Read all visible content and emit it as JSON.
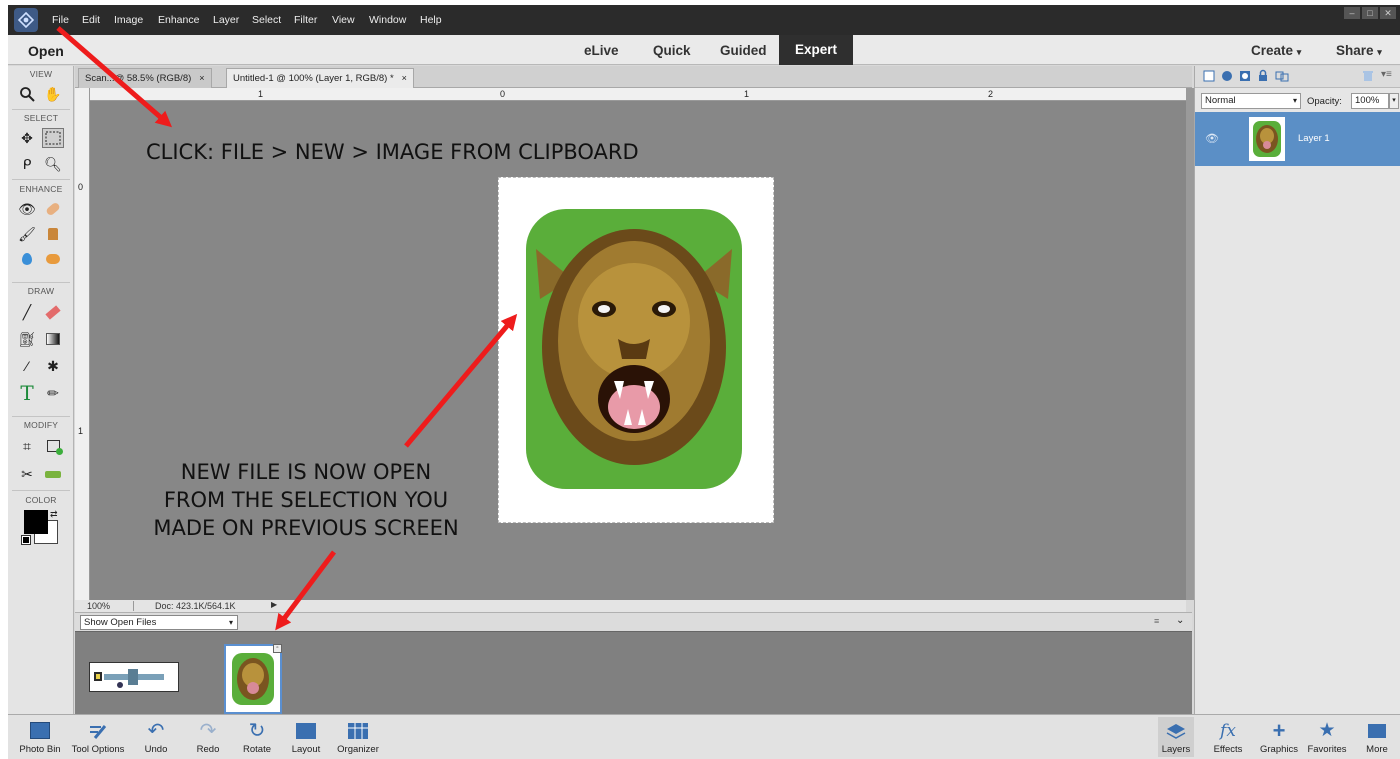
{
  "menubar": {
    "items": [
      "File",
      "Edit",
      "Image",
      "Enhance",
      "Layer",
      "Select",
      "Filter",
      "View",
      "Window",
      "Help"
    ],
    "window_controls": [
      "–",
      "□",
      "✕"
    ]
  },
  "modebar": {
    "open_label": "Open",
    "modes": [
      "eLive",
      "Quick",
      "Guided",
      "Expert"
    ],
    "active_mode": "Expert",
    "create_label": "Create",
    "share_label": "Share"
  },
  "toolbox": {
    "sections": [
      "VIEW",
      "SELECT",
      "ENHANCE",
      "DRAW",
      "MODIFY",
      "COLOR"
    ]
  },
  "doc_tabs": [
    {
      "label": "Scan...@ 58.5% (RGB/8)",
      "close": "×"
    },
    {
      "label": "Untitled-1 @ 100% (Layer 1, RGB/8) *",
      "close": "×"
    }
  ],
  "rulers": {
    "h_numbers": [
      "1",
      "0",
      "1",
      "2"
    ],
    "v_numbers": [
      "0",
      "1"
    ]
  },
  "status": {
    "zoom": "100%",
    "doc": "Doc: 423.1K/564.1K"
  },
  "photo_bin": {
    "select_value": "Show Open Files"
  },
  "layers_panel": {
    "blend_mode": "Normal",
    "opacity_label": "Opacity:",
    "opacity_value": "100%",
    "layer_name": "Layer 1"
  },
  "annotations": {
    "instruction": "CLICK: FILE > NEW > IMAGE FROM CLIPBOARD",
    "note_line1": "NEW FILE IS NOW OPEN",
    "note_line2": "FROM THE SELECTION YOU",
    "note_line3": "MADE ON PREVIOUS SCREEN"
  },
  "bottombar": {
    "left": [
      "Photo Bin",
      "Tool Options",
      "Undo",
      "Redo",
      "Rotate",
      "Layout",
      "Organizer"
    ],
    "right": [
      "Layers",
      "Effects",
      "Graphics",
      "Favorites",
      "More"
    ]
  },
  "colors": {
    "annotation_arrow": "#ee1c1c",
    "active_layer": "#5b8fc6",
    "mask_green": "#5aae3a"
  }
}
